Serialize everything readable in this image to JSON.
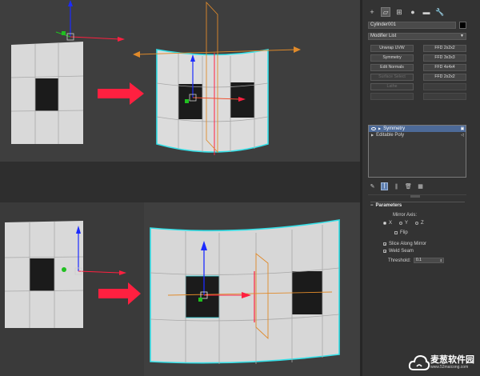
{
  "panel": {
    "tabs": [
      {
        "icon": "create-icon",
        "glyph": "+"
      },
      {
        "icon": "modify-icon",
        "glyph": "▱",
        "active": true
      },
      {
        "icon": "hierarchy-icon",
        "glyph": "⊞"
      },
      {
        "icon": "motion-icon",
        "glyph": "●"
      },
      {
        "icon": "display-icon",
        "glyph": "▬"
      },
      {
        "icon": "utilities-icon",
        "glyph": "🔧"
      }
    ],
    "object_name": "Cylinder001",
    "object_color": "#000000",
    "modifier_list": "Modifier List",
    "modifier_buttons": [
      "Unwrap UVW",
      "FFD 2x2x2",
      "Symmetry",
      "FFD 3x3x3",
      "Edit Normals",
      "FFD 4x4x4",
      "Surface Select",
      "FFD 2x2x2",
      "Lathe",
      "",
      "",
      ""
    ],
    "stack": [
      {
        "label": "Symmetry",
        "selected": true
      },
      {
        "label": "Editable Poly",
        "selected": false
      }
    ],
    "parameters": {
      "title": "Parameters",
      "mirror_axis_label": "Mirror Axis:",
      "axes": [
        "X",
        "Y",
        "Z"
      ],
      "selected_axis": "X",
      "flip_label": "Flip",
      "slice_label": "Slice Along Mirror",
      "weld_label": "Weld Seam",
      "threshold_label": "Threshold:",
      "threshold_value": "0.1"
    }
  },
  "watermark": {
    "brand": "麦葱软件园",
    "url": "www.52maicong.com"
  },
  "colors": {
    "selection_edge": "#35e0e8",
    "arrow_red": "#ff2040",
    "axis_blue": "#1c2bff",
    "axis_green": "#20c020",
    "gizmo_orange": "#e08a2a",
    "stack_selected": "#4d6a98"
  }
}
